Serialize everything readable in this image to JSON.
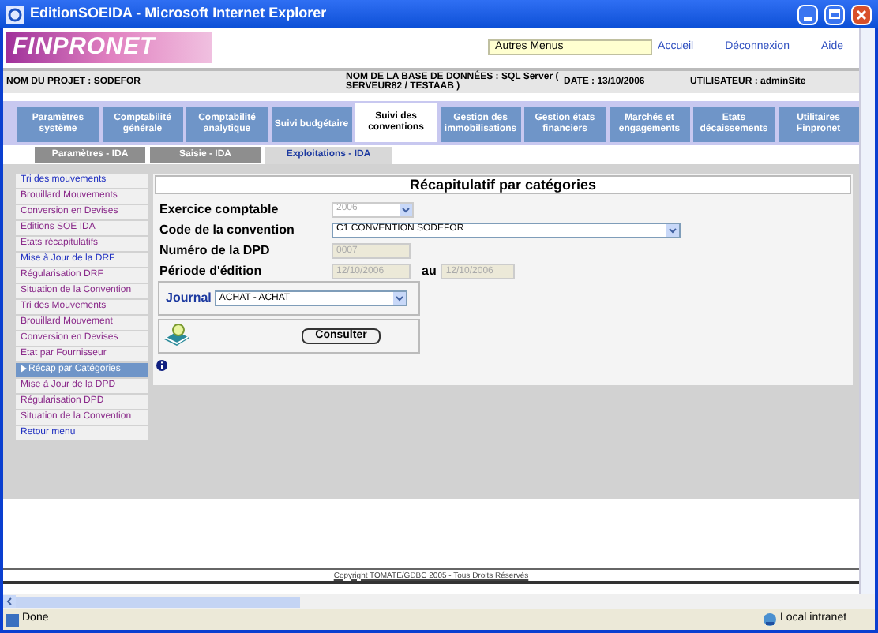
{
  "window": {
    "title": "EditionSOEIDA - Microsoft Internet Explorer"
  },
  "header": {
    "logo": "FINPRONET",
    "menu_field": {
      "value": "Autres Menus"
    },
    "links": [
      "Accueil",
      "Déconnexion",
      "Aide"
    ]
  },
  "info_bar": {
    "project": "NOM DU PROJET : SODEFOR",
    "database": "NOM DE LA BASE DE DONNÉES : SQL Server ( SERVEUR82 / TESTAAB )",
    "date": "DATE : 13/10/2006",
    "user": "UTILISATEUR : adminSite"
  },
  "tabs": [
    {
      "label": "Paramètres système",
      "selected": false
    },
    {
      "label": "Comptabilité générale",
      "selected": false
    },
    {
      "label": "Comptabilité analytique",
      "selected": false
    },
    {
      "label": "Suivi budgétaire",
      "selected": false
    },
    {
      "label": "Suivi des conventions",
      "selected": true
    },
    {
      "label": "Gestion des immobilisations",
      "selected": false
    },
    {
      "label": "Gestion états financiers",
      "selected": false
    },
    {
      "label": "Marchés et engagements",
      "selected": false
    },
    {
      "label": "Etats décaissements",
      "selected": false
    },
    {
      "label": "Utilitaires Finpronet",
      "selected": false
    }
  ],
  "subtabs": [
    {
      "label": "Paramètres - IDA",
      "selected": false
    },
    {
      "label": "Saisie - IDA",
      "selected": false
    },
    {
      "label": "Exploitations - IDA",
      "selected": true
    }
  ],
  "sidebar": {
    "items": [
      {
        "label": "Tri des mouvements",
        "selected": false,
        "visited": false
      },
      {
        "label": "Brouillard Mouvements",
        "selected": false,
        "visited": true
      },
      {
        "label": "Conversion en Devises",
        "selected": false,
        "visited": true
      },
      {
        "label": "Editions SOE IDA",
        "selected": false,
        "visited": true
      },
      {
        "label": "Etats récapitulatifs",
        "selected": false,
        "visited": true
      },
      {
        "label": "Mise à Jour de la DRF",
        "selected": false,
        "visited": false
      },
      {
        "label": "Régularisation DRF",
        "selected": false,
        "visited": true
      },
      {
        "label": "Situation de la Convention",
        "selected": false,
        "visited": true
      },
      {
        "label": "Tri des Mouvements",
        "selected": false,
        "visited": true
      },
      {
        "label": "Brouillard Mouvement",
        "selected": false,
        "visited": true
      },
      {
        "label": "Conversion en Devises",
        "selected": false,
        "visited": true
      },
      {
        "label": "Etat par Fournisseur",
        "selected": false,
        "visited": true
      },
      {
        "label": "Récap par Catégories",
        "selected": true
      },
      {
        "label": "Mise à Jour de la DPD",
        "selected": false,
        "visited": true
      },
      {
        "label": "Régularisation DPD",
        "selected": false,
        "visited": true
      },
      {
        "label": "Situation de la Convention",
        "selected": false,
        "visited": true
      },
      {
        "label": "Retour menu",
        "selected": false,
        "visited": false
      }
    ]
  },
  "form": {
    "title": "Récapitulatif par catégories",
    "exercice": {
      "label": "Exercice comptable",
      "value": "2006",
      "disabled": true
    },
    "convention": {
      "label": "Code de la convention",
      "value": "C1 CONVENTION SODEFOR",
      "disabled": false
    },
    "dpd": {
      "label": "Numéro de la DPD",
      "value": "0007",
      "disabled": true
    },
    "periode": {
      "label": "Période d'édition",
      "from": "12/10/2006",
      "to_label": "au",
      "to": "12/10/2006",
      "disabled": true
    },
    "journal": {
      "label": "Journal",
      "value": "ACHAT - ACHAT"
    },
    "button": "Consulter"
  },
  "footer": {
    "copyright": "Copyright TOMATE/GDBC 2005 - Tous Droits Réservés"
  },
  "status_bar": {
    "text": "Done",
    "zone": "Local intranet"
  }
}
